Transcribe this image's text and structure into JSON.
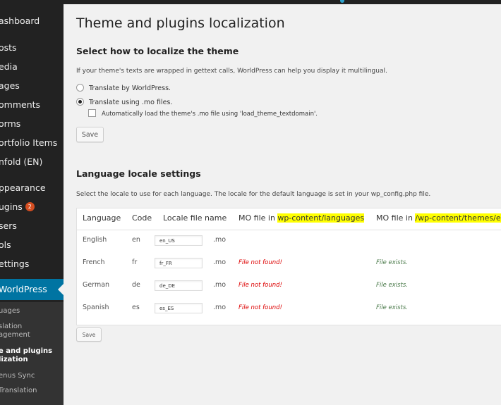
{
  "sidebar": {
    "items": [
      {
        "label": "ashboard"
      },
      {
        "label": "osts"
      },
      {
        "label": "edia"
      },
      {
        "label": "ages"
      },
      {
        "label": "omments"
      },
      {
        "label": "orms"
      },
      {
        "label": "ortfolio Items"
      },
      {
        "label": "nfold (EN)"
      },
      {
        "label": "ppearance"
      },
      {
        "label": "ugins",
        "badge": "2"
      },
      {
        "label": "sers"
      },
      {
        "label": "ols"
      },
      {
        "label": "ettings"
      },
      {
        "label": "WorldPress"
      }
    ],
    "submenu": [
      {
        "label": "uages"
      },
      {
        "label": "slation"
      },
      {
        "label": "agement"
      },
      {
        "label": "e and plugins"
      },
      {
        "label": "lization"
      },
      {
        "label": "enus Sync"
      },
      {
        "label": "Translation"
      }
    ]
  },
  "page": {
    "title": "Theme and plugins localization",
    "section1": {
      "heading": "Select how to localize the theme",
      "description": "If your theme's texts are wrapped in gettext calls, WorldPress can help you display it multilingual.",
      "radio1": "Translate by WorldPress.",
      "radio2": "Translate using .mo files.",
      "checkbox": "Automatically load the theme's .mo file using 'load_theme_textdomain'.",
      "save": "Save"
    },
    "section2": {
      "heading": "Language locale settings",
      "description": "Select the locale to use for each language. The locale for the default language is set in your wp_config.php file.",
      "save": "Save"
    }
  },
  "table": {
    "headers": {
      "language": "Language",
      "code": "Code",
      "locale": "Locale file name",
      "mo_languages_prefix": "MO file in ",
      "mo_languages_path": "wp-content/languages",
      "mo_themes_prefix": "MO file in ",
      "mo_themes_path": "/wp-content/themes/en"
    },
    "rows": [
      {
        "language": "English",
        "code": "en",
        "locale": "en_US",
        "ext": ".mo",
        "languages_status": "",
        "themes_status": ""
      },
      {
        "language": "French",
        "code": "fr",
        "locale": "fr_FR",
        "ext": ".mo",
        "languages_status": "File not found!",
        "themes_status": "File exists."
      },
      {
        "language": "German",
        "code": "de",
        "locale": "de_DE",
        "ext": ".mo",
        "languages_status": "File not found!",
        "themes_status": "File exists."
      },
      {
        "language": "Spanish",
        "code": "es",
        "locale": "es_ES",
        "ext": ".mo",
        "languages_status": "File not found!",
        "themes_status": "File exists."
      }
    ]
  },
  "colors": {
    "sidebar_bg": "#222222",
    "active_menu": "#0074a2",
    "highlight": "#ffff00",
    "error": "#dd0000",
    "success": "#4a7a4a"
  }
}
